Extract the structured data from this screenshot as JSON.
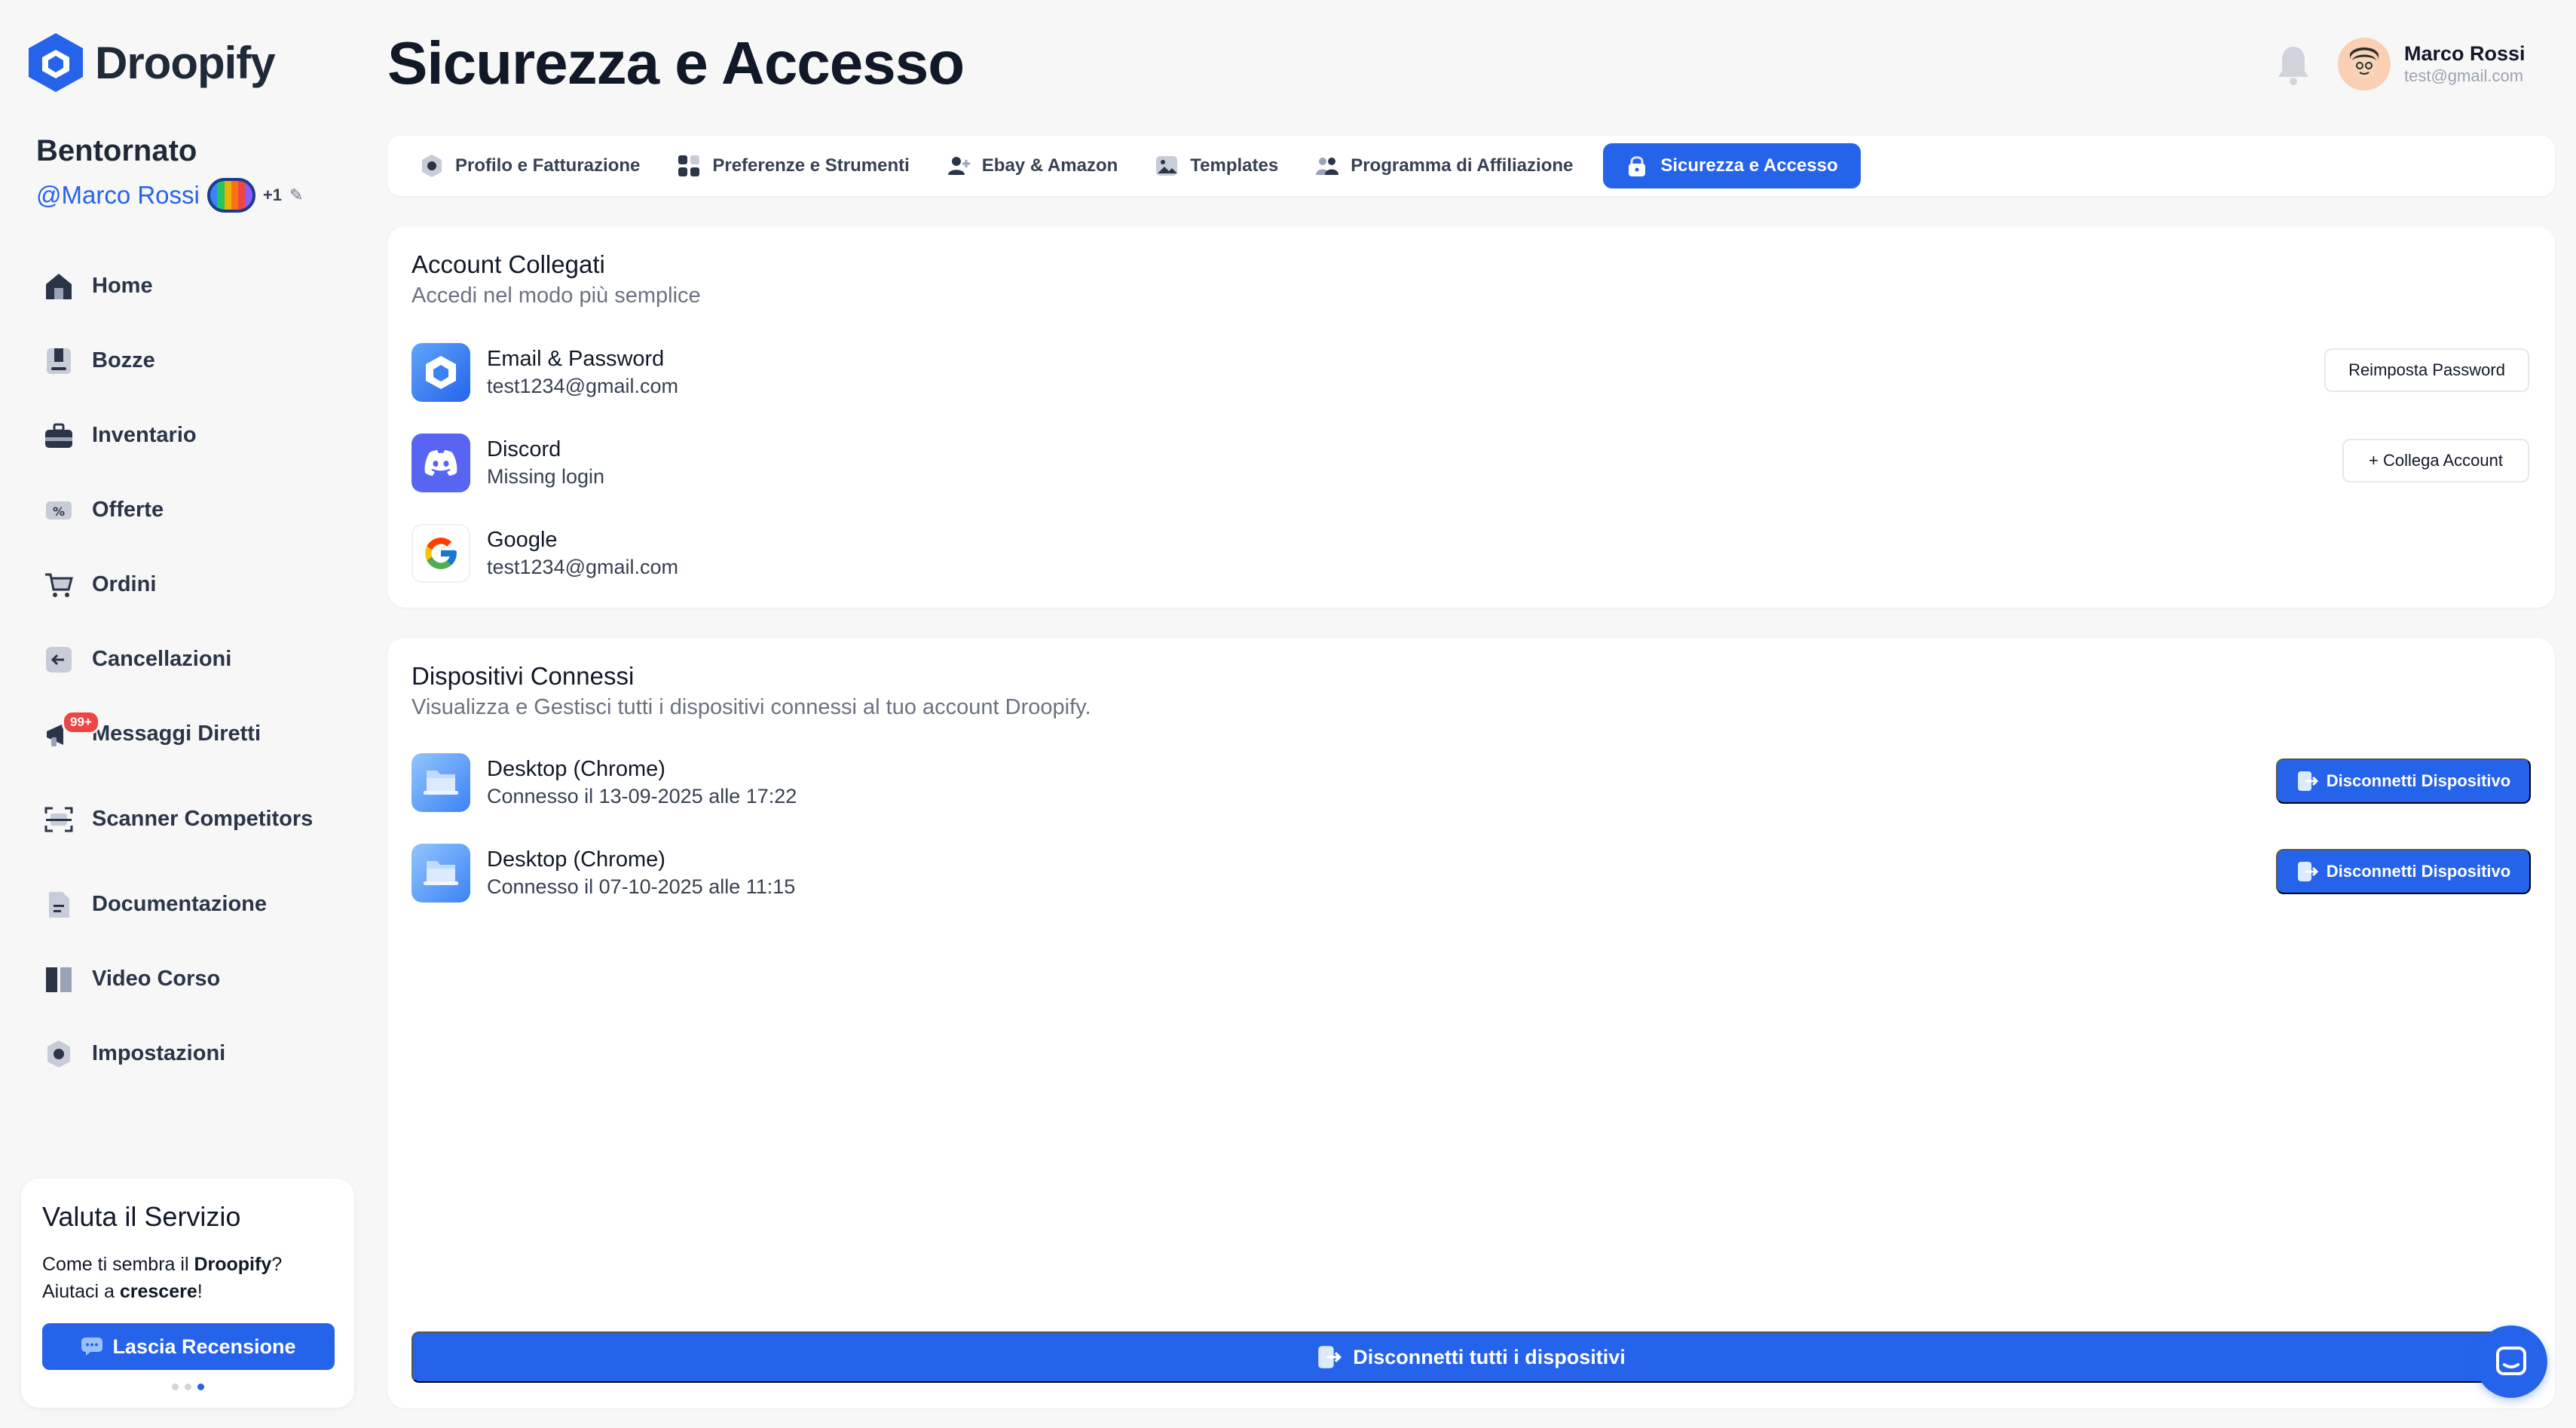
{
  "app": {
    "brand": "Droopify"
  },
  "sidebar": {
    "welcome": "Bentornato",
    "handle": "@Marco Rossi",
    "plus_count": "+1",
    "items": [
      {
        "label": "Home",
        "icon": "home-icon"
      },
      {
        "label": "Bozze",
        "icon": "drafts-icon"
      },
      {
        "label": "Inventario",
        "icon": "briefcase-icon"
      },
      {
        "label": "Offerte",
        "icon": "offer-tag-icon"
      },
      {
        "label": "Ordini",
        "icon": "cart-icon"
      },
      {
        "label": "Cancellazioni",
        "icon": "arrow-left-box-icon"
      },
      {
        "label": "Messaggi Diretti",
        "icon": "megaphone-icon",
        "badge": "99+"
      },
      {
        "label": "Scanner Competitors",
        "icon": "scanner-icon"
      },
      {
        "label": "Documentazione",
        "icon": "document-icon"
      },
      {
        "label": "Video Corso",
        "icon": "book-icon"
      },
      {
        "label": "Impostazioni",
        "icon": "gear-icon"
      }
    ],
    "review": {
      "title": "Valuta il Servizio",
      "text_pre": "Come ti sembra il ",
      "text_brand": "Droopify",
      "text_mid": "?",
      "text_line2_pre": "Aiutaci a ",
      "text_line2_bold": "crescere",
      "text_line2_post": "!",
      "button": "Lascia Recensione"
    }
  },
  "header": {
    "title": "Sicurezza e Accesso",
    "user_name": "Marco Rossi",
    "user_email": "test@gmail.com"
  },
  "tabs": [
    {
      "label": "Profilo e Fatturazione",
      "icon": "profile-gear-icon",
      "active": false
    },
    {
      "label": "Preferenze e Strumenti",
      "icon": "tools-grid-icon",
      "active": false
    },
    {
      "label": "Ebay & Amazon",
      "icon": "user-plus-icon",
      "active": false
    },
    {
      "label": "Templates",
      "icon": "image-icon",
      "active": false
    },
    {
      "label": "Programma di Affiliazione",
      "icon": "users-icon",
      "active": false
    },
    {
      "label": "Sicurezza e Accesso",
      "icon": "lock-icon",
      "active": true
    }
  ],
  "accounts": {
    "title": "Account Collegati",
    "subtitle": "Accedi nel modo più semplice",
    "items": [
      {
        "name": "Email & Password",
        "detail": "test1234@gmail.com",
        "icon": "droopify-logo-icon",
        "action": "Reimposta Password"
      },
      {
        "name": "Discord",
        "detail": "Missing login",
        "icon": "discord-icon",
        "action": "+ Collega Account"
      },
      {
        "name": "Google",
        "detail": "test1234@gmail.com",
        "icon": "google-icon",
        "action": ""
      }
    ]
  },
  "devices": {
    "title": "Dispositivi Connessi",
    "subtitle": "Visualizza e Gestisci tutti i dispositivi connessi al tuo account Droopify.",
    "items": [
      {
        "name": "Desktop (Chrome)",
        "detail": "Connesso il 13-09-2025 alle 17:22",
        "action": "Disconnetti Dispositivo"
      },
      {
        "name": "Desktop (Chrome)",
        "detail": "Connesso il 07-10-2025 alle 11:15",
        "action": "Disconnetti Dispositivo"
      }
    ],
    "disconnect_all": "Disconnetti tutti i dispositivi"
  },
  "colors": {
    "accent": "#2563eb",
    "badge": "#ef4444",
    "discord": "#5865f2"
  }
}
